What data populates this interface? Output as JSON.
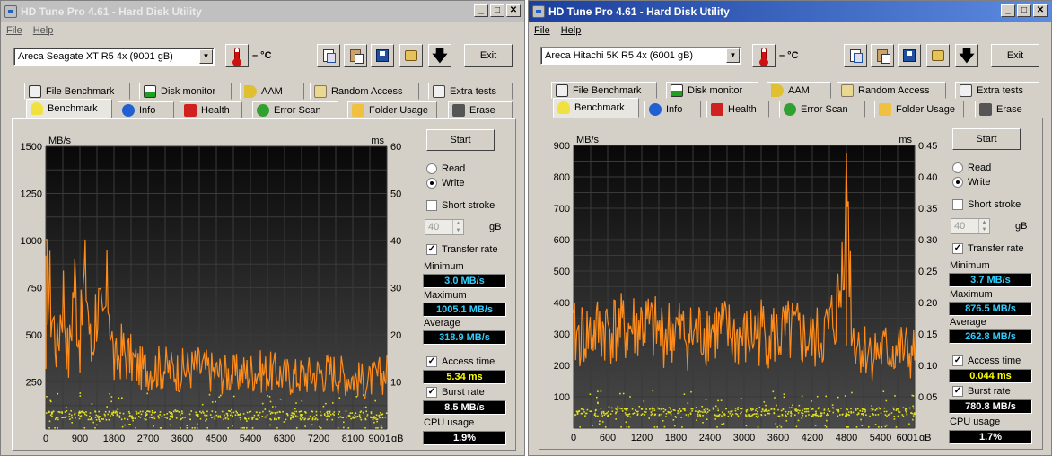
{
  "colors": {
    "transfer": "#ff8c1a",
    "access": "#e0e020",
    "grid": "#3a3a3a",
    "cyan": "#2fd0ff"
  },
  "windows": [
    {
      "title": "HD Tune Pro 4.61 - Hard Disk Utility",
      "active": false,
      "menu": {
        "file": "File",
        "help": "Help"
      },
      "drive": "Areca   Seagate XT R5 4x (9001 gB)",
      "temp": "– °C",
      "exit": "Exit",
      "tabs_top": [
        "File Benchmark",
        "Disk monitor",
        "AAM",
        "Random Access",
        "Extra tests"
      ],
      "tabs_bottom": [
        "Benchmark",
        "Info",
        "Health",
        "Error Scan",
        "Folder Usage",
        "Erase"
      ],
      "start": "Start",
      "read": "Read",
      "write": "Write",
      "short_stroke": "Short stroke",
      "stroke_val": "40",
      "stroke_unit": "gB",
      "transfer_rate": "Transfer rate",
      "minimum_label": "Minimum",
      "minimum": "3.0 MB/s",
      "maximum_label": "Maximum",
      "maximum": "1005.1 MB/s",
      "average_label": "Average",
      "average": "318.9 MB/s",
      "access_time_label": "Access time",
      "access_time": "5.34 ms",
      "burst_rate_label": "Burst rate",
      "burst_rate": "8.5 MB/s",
      "cpu_label": "CPU usage",
      "cpu": "1.9%"
    },
    {
      "title": "HD Tune Pro 4.61 - Hard Disk Utility",
      "active": true,
      "menu": {
        "file": "File",
        "help": "Help"
      },
      "drive": "Areca   Hitachi 5K R5 4x (6001 gB)",
      "temp": "– °C",
      "exit": "Exit",
      "tabs_top": [
        "File Benchmark",
        "Disk monitor",
        "AAM",
        "Random Access",
        "Extra tests"
      ],
      "tabs_bottom": [
        "Benchmark",
        "Info",
        "Health",
        "Error Scan",
        "Folder Usage",
        "Erase"
      ],
      "start": "Start",
      "read": "Read",
      "write": "Write",
      "short_stroke": "Short stroke",
      "stroke_val": "40",
      "stroke_unit": "gB",
      "transfer_rate": "Transfer rate",
      "minimum_label": "Minimum",
      "minimum": "3.7 MB/s",
      "maximum_label": "Maximum",
      "maximum": "876.5 MB/s",
      "average_label": "Average",
      "average": "262.8 MB/s",
      "access_time_label": "Access time",
      "access_time": "0.044 ms",
      "burst_rate_label": "Burst rate",
      "burst_rate": "780.8 MB/s",
      "cpu_label": "CPU usage",
      "cpu": "1.7%"
    }
  ],
  "chart_data": [
    {
      "type": "line",
      "ylabel_left": "MB/s",
      "ylabel_right": "ms",
      "x_unit": "gB",
      "ylim": [
        0,
        1500
      ],
      "y2lim": [
        0,
        60
      ],
      "xlim": [
        0,
        9001
      ],
      "y_ticks": [
        "1500",
        "1250",
        "1000",
        "750",
        "500",
        "250"
      ],
      "y2_ticks": [
        "60",
        "50",
        "40",
        "30",
        "20",
        "10"
      ],
      "x_ticks": [
        "0",
        "900",
        "1800",
        "2700",
        "3600",
        "4500",
        "5400",
        "6300",
        "7200",
        "8100",
        "9001"
      ],
      "series": [
        {
          "role": "transfer",
          "avg": 318.9,
          "max": 1005.1,
          "min": 3.0,
          "x": [
            0,
            150,
            300,
            450,
            600,
            750,
            900,
            1050,
            1200,
            1350,
            1500,
            1650,
            1800,
            2000,
            2500,
            3000,
            3500,
            4000,
            4500,
            5000,
            5500,
            6000,
            6500,
            7000,
            7500,
            8000,
            8500,
            9001
          ],
          "values": [
            920,
            650,
            420,
            760,
            350,
            820,
            450,
            880,
            380,
            700,
            500,
            760,
            330,
            420,
            320,
            330,
            310,
            330,
            300,
            290,
            310,
            300,
            280,
            290,
            310,
            280,
            250,
            300
          ]
        },
        {
          "role": "access",
          "mean_ms": 5.34
        }
      ]
    },
    {
      "type": "line",
      "ylabel_left": "MB/s",
      "ylabel_right": "ms",
      "x_unit": "gB",
      "ylim": [
        0,
        900
      ],
      "y2lim": [
        0,
        0.45
      ],
      "xlim": [
        0,
        6001
      ],
      "y_ticks": [
        "900",
        "800",
        "700",
        "600",
        "500",
        "400",
        "300",
        "200",
        "100"
      ],
      "y2_ticks": [
        "0.45",
        "0.40",
        "0.35",
        "0.30",
        "0.25",
        "0.20",
        "0.15",
        "0.10",
        "0.05"
      ],
      "x_ticks": [
        "0",
        "600",
        "1200",
        "1800",
        "2400",
        "3000",
        "3600",
        "4200",
        "4800",
        "5400",
        "6001"
      ],
      "series": [
        {
          "role": "transfer",
          "avg": 262.8,
          "max": 876.5,
          "min": 3.7,
          "x": [
            0,
            300,
            600,
            900,
            1200,
            1500,
            1800,
            2100,
            2400,
            2700,
            3000,
            3300,
            3600,
            3900,
            4200,
            4500,
            4700,
            4800,
            4900,
            5100,
            5400,
            5700,
            6001
          ],
          "values": [
            290,
            300,
            320,
            310,
            330,
            300,
            310,
            290,
            320,
            300,
            280,
            310,
            290,
            300,
            270,
            310,
            420,
            876,
            300,
            250,
            240,
            250,
            230
          ]
        },
        {
          "role": "access",
          "mean_ms": 0.044
        }
      ]
    }
  ]
}
